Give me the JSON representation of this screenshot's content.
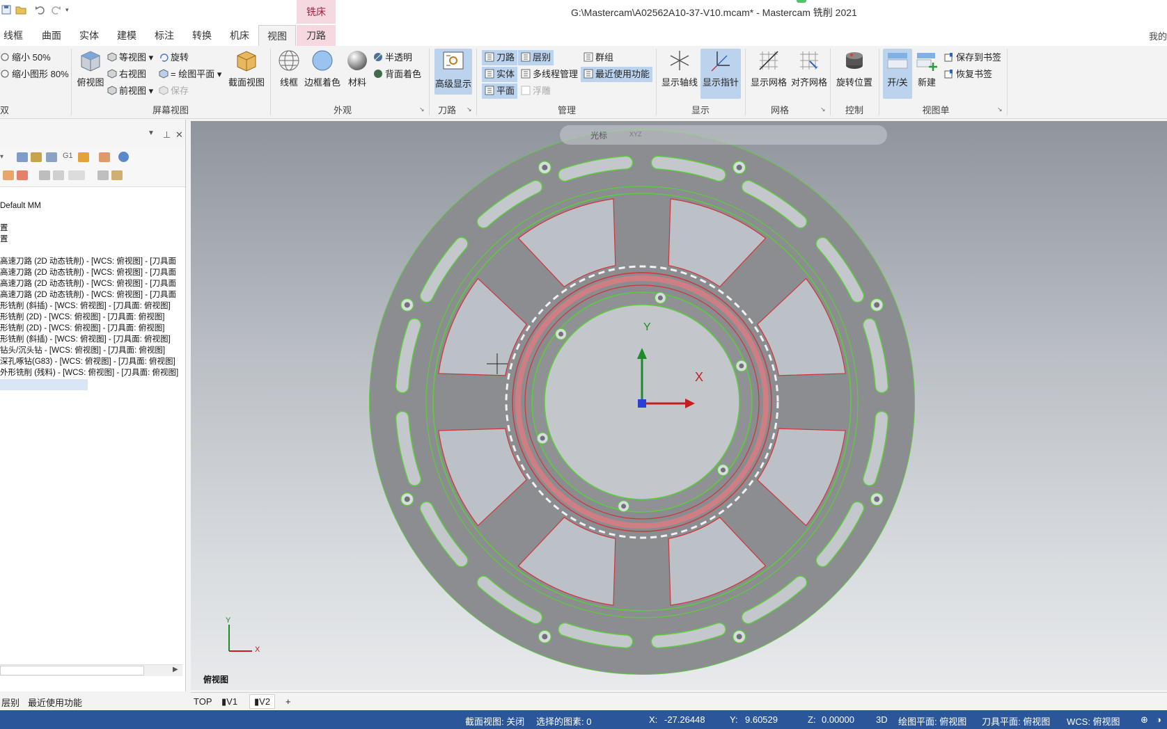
{
  "titlebar": {
    "title": "G:\\Mastercam\\A02562A10-37-V10.mcam* - Mastercam 铣削 2021",
    "context_tab": "铣床"
  },
  "tabs": [
    "线框",
    "曲面",
    "实体",
    "建模",
    "标注",
    "转换",
    "机床",
    "视图",
    "刀路"
  ],
  "user_hint": "我的",
  "ribbon": {
    "zoom": {
      "shrink50": "缩小 50%",
      "shrink80": "缩小图形 80%",
      "group_label": "双"
    },
    "screen": {
      "top_view": "俯视图",
      "iso_view": "等视图",
      "right_view": "右视图",
      "front_view": "前视图",
      "rotate": "旋转",
      "plane": "= 绘图平面",
      "save": "保存",
      "section_view": "截面视图",
      "group_label": "屏幕视图"
    },
    "appearance": {
      "wireframe": "线框",
      "edge_shade": "边框着色",
      "material": "材料",
      "translucent": "半透明",
      "back_shade": "背面着色",
      "group_label": "外观"
    },
    "toolpath": {
      "advanced": "高级显示",
      "group_label": "刀路"
    },
    "manage": {
      "toolpath": "刀路",
      "levels": "层别",
      "groups": "群组",
      "solids": "实体",
      "multi_thread": "多线程管理",
      "recent": "最近使用功能",
      "planes": "平面",
      "float": "浮雕",
      "group_label": "管理"
    },
    "display": {
      "axes": "显示轴线",
      "gnomon": "显示指针",
      "group_label": "显示"
    },
    "grid": {
      "show_grid": "显示网格",
      "snap_grid": "对齐网格",
      "group_label": "网格"
    },
    "control": {
      "rotate_pos": "旋转位置",
      "group_label": "控制"
    },
    "viewsheet": {
      "toggle": "开/关",
      "new": "新建",
      "save_bookmark": "保存到书签",
      "restore_bookmark": "恢复书签",
      "group_label": "视图单"
    }
  },
  "panel": {
    "machine": "Default MM",
    "props": [
      "置",
      "置"
    ],
    "ops": [
      "高速刀路 (2D 动态铣削) - [WCS: 俯视图] - [刀具面",
      "高速刀路 (2D 动态铣削) - [WCS: 俯视图] - [刀具面",
      "高速刀路 (2D 动态铣削) - [WCS: 俯视图] - [刀具面",
      "高速刀路 (2D 动态铣削) - [WCS: 俯视图] - [刀具面",
      "形铣削 (斜插) - [WCS: 俯视图] - [刀具面: 俯视图]",
      "形铣削 (2D) - [WCS: 俯视图] - [刀具面: 俯视图]",
      "形铣削 (2D) - [WCS: 俯视图] - [刀具面: 俯视图]",
      "形铣削 (斜插) - [WCS: 俯视图] - [刀具面: 俯视图]",
      "钻头/沉头钻 - [WCS: 俯视图] - [刀具面: 俯视图]",
      "深孔啄钻(G83) - [WCS: 俯视图] - [刀具面: 俯视图]",
      "外形铣削 (残料) - [WCS: 俯视图] - [刀具面: 俯视图]"
    ],
    "tool_g1": "G1",
    "bottom_tabs": [
      "层别",
      "最近使用功能"
    ]
  },
  "viewport": {
    "view_name": "俯视图",
    "axis_x": "X",
    "axis_y": "Y",
    "toolbar_cursor": "光标",
    "toolbar_xyz": "XYZ"
  },
  "view_tabs": [
    "TOP",
    "V1",
    "V2",
    "+"
  ],
  "status": {
    "section": "截面视图: 关闭",
    "selected": "选择的图素: 0",
    "x_label": "X:",
    "x_value": "-27.26448",
    "y_label": "Y:",
    "y_value": "9.60529",
    "z_label": "Z:",
    "z_value": "0.00000",
    "mode": "3D",
    "cplane": "绘图平面: 俯视图",
    "tplane": "刀具平面: 俯视图",
    "wcs": "WCS: 俯视图"
  },
  "colors": {
    "accent": "#2b579a",
    "context_tab": "#f6d9e0",
    "part_outline": "#5ccc3c",
    "edge_red": "#d0343a"
  }
}
